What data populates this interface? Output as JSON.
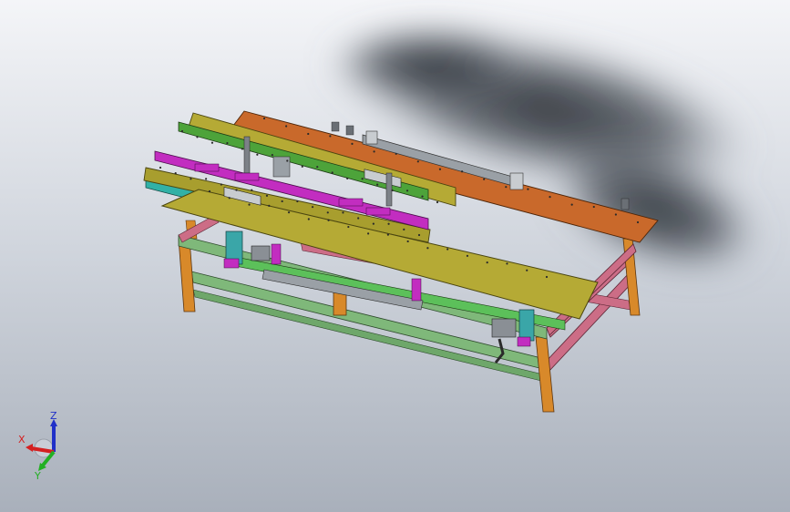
{
  "triad": {
    "x_label": "X",
    "y_label": "Y",
    "z_label": "Z",
    "x_color": "#d42020",
    "y_color": "#22b022",
    "z_color": "#2030c8"
  },
  "colors": {
    "background_top": "#f4f5f8",
    "background_bottom": "#a9b0bb",
    "frame_leg": "#d8892a",
    "frame_rail": "#cc6d86",
    "beam_green": "#7fb87a",
    "deck_olive": "#b5aa35",
    "deck_back": "#c9692b",
    "rail_green": "#4da33a",
    "rail_magenta": "#c22dc0",
    "conveyor_teal": "#31b1a6",
    "motor_teal": "#3aa6a8"
  }
}
